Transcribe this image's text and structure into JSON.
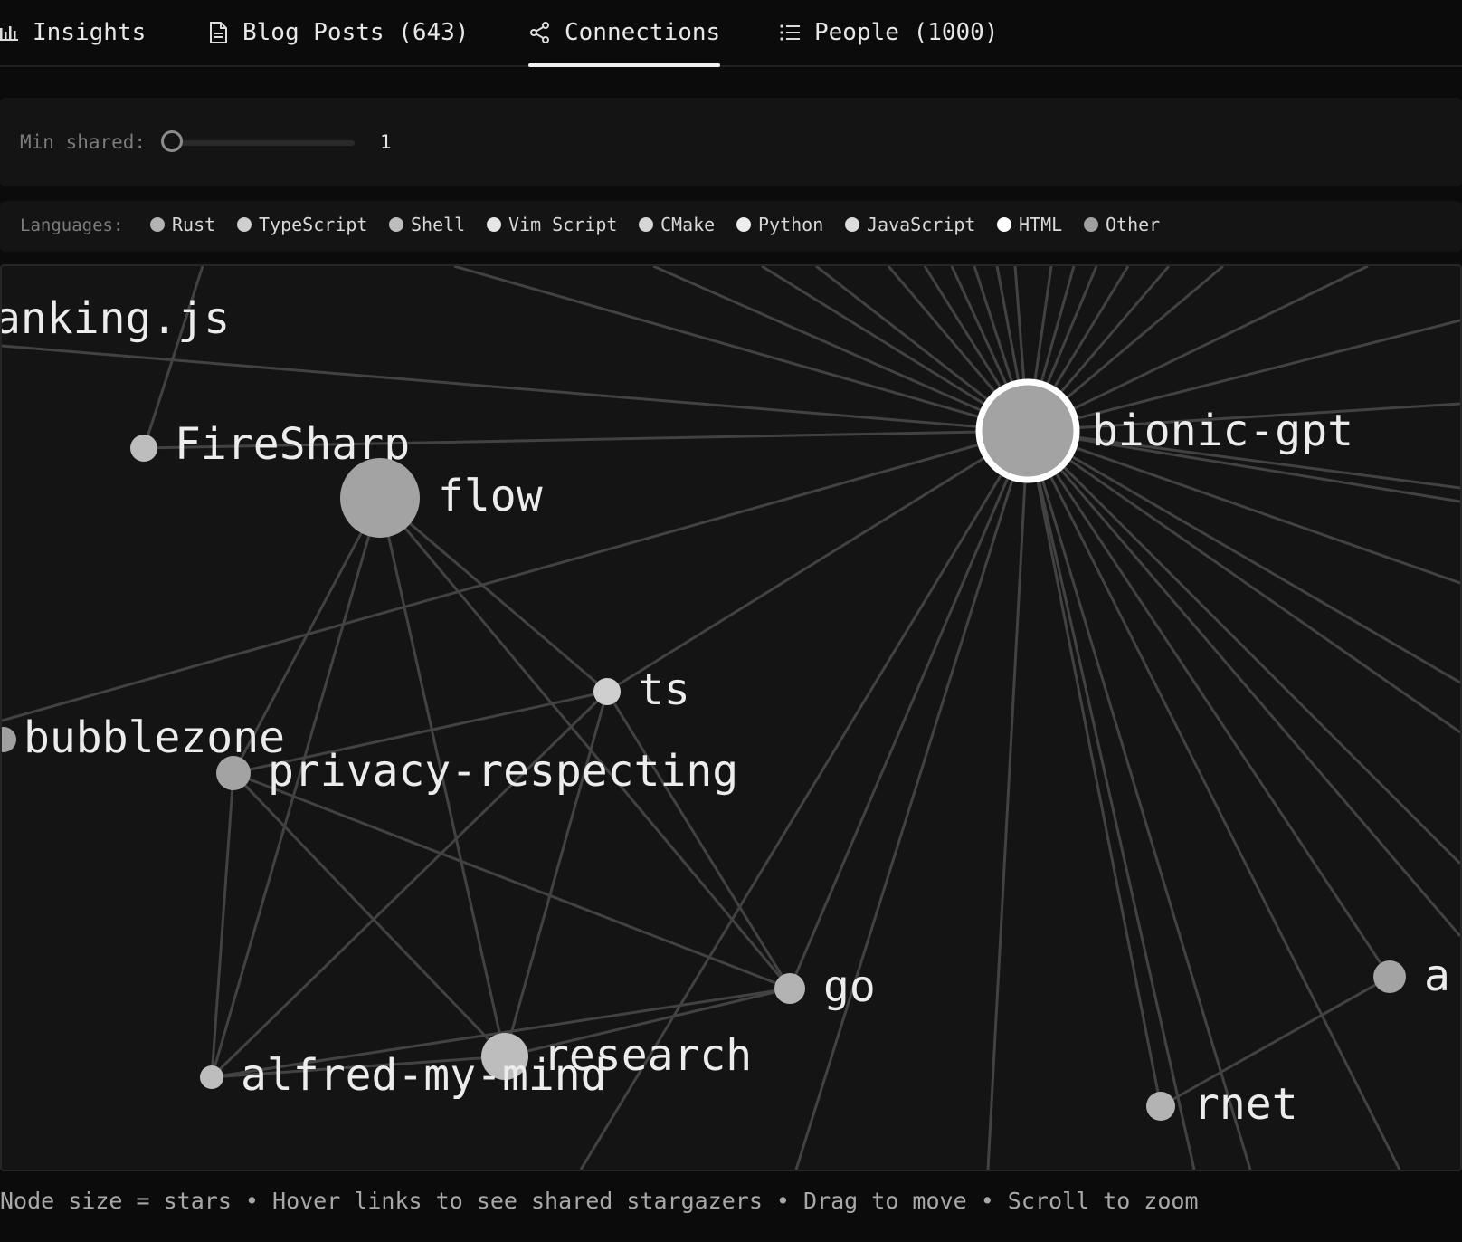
{
  "tabs": [
    {
      "label": "Insights",
      "icon": "bar-chart-icon",
      "active": false
    },
    {
      "label": "Blog Posts (643)",
      "icon": "document-icon",
      "active": false
    },
    {
      "label": "Connections",
      "icon": "share-icon",
      "active": true
    },
    {
      "label": "People (1000)",
      "icon": "list-icon",
      "active": false
    }
  ],
  "filter": {
    "min_shared_label": "Min shared:",
    "min_shared_value": "1"
  },
  "languages": {
    "label": "Languages:",
    "items": [
      {
        "name": "Rust",
        "color": "#b3b3b3"
      },
      {
        "name": "TypeScript",
        "color": "#cfcfcf"
      },
      {
        "name": "Shell",
        "color": "#bdbdbd"
      },
      {
        "name": "Vim Script",
        "color": "#e6e6e6"
      },
      {
        "name": "CMake",
        "color": "#d6d6d6"
      },
      {
        "name": "Python",
        "color": "#ededed"
      },
      {
        "name": "JavaScript",
        "color": "#dcdcdc"
      },
      {
        "name": "HTML",
        "color": "#ffffff"
      },
      {
        "name": "Other",
        "color": "#a0a0a0"
      }
    ]
  },
  "graph": {
    "nodes": [
      {
        "id": "ranking",
        "label": "anking.js"
      },
      {
        "id": "firesharp",
        "label": "FireSharp"
      },
      {
        "id": "flow",
        "label": "flow"
      },
      {
        "id": "bionic",
        "label": "bionic-gpt"
      },
      {
        "id": "ts",
        "label": "ts"
      },
      {
        "id": "bubblezone",
        "label": "bubblezone"
      },
      {
        "id": "privacy",
        "label": "privacy-respecting"
      },
      {
        "id": "go",
        "label": "go"
      },
      {
        "id": "research",
        "label": "research"
      },
      {
        "id": "alfred",
        "label": "alfred-my-mind"
      },
      {
        "id": "rnet",
        "label": "rnet"
      },
      {
        "id": "a",
        "label": "a"
      }
    ]
  },
  "footer": "Node size = stars • Hover links to see shared stargazers • Drag to move • Scroll to zoom"
}
